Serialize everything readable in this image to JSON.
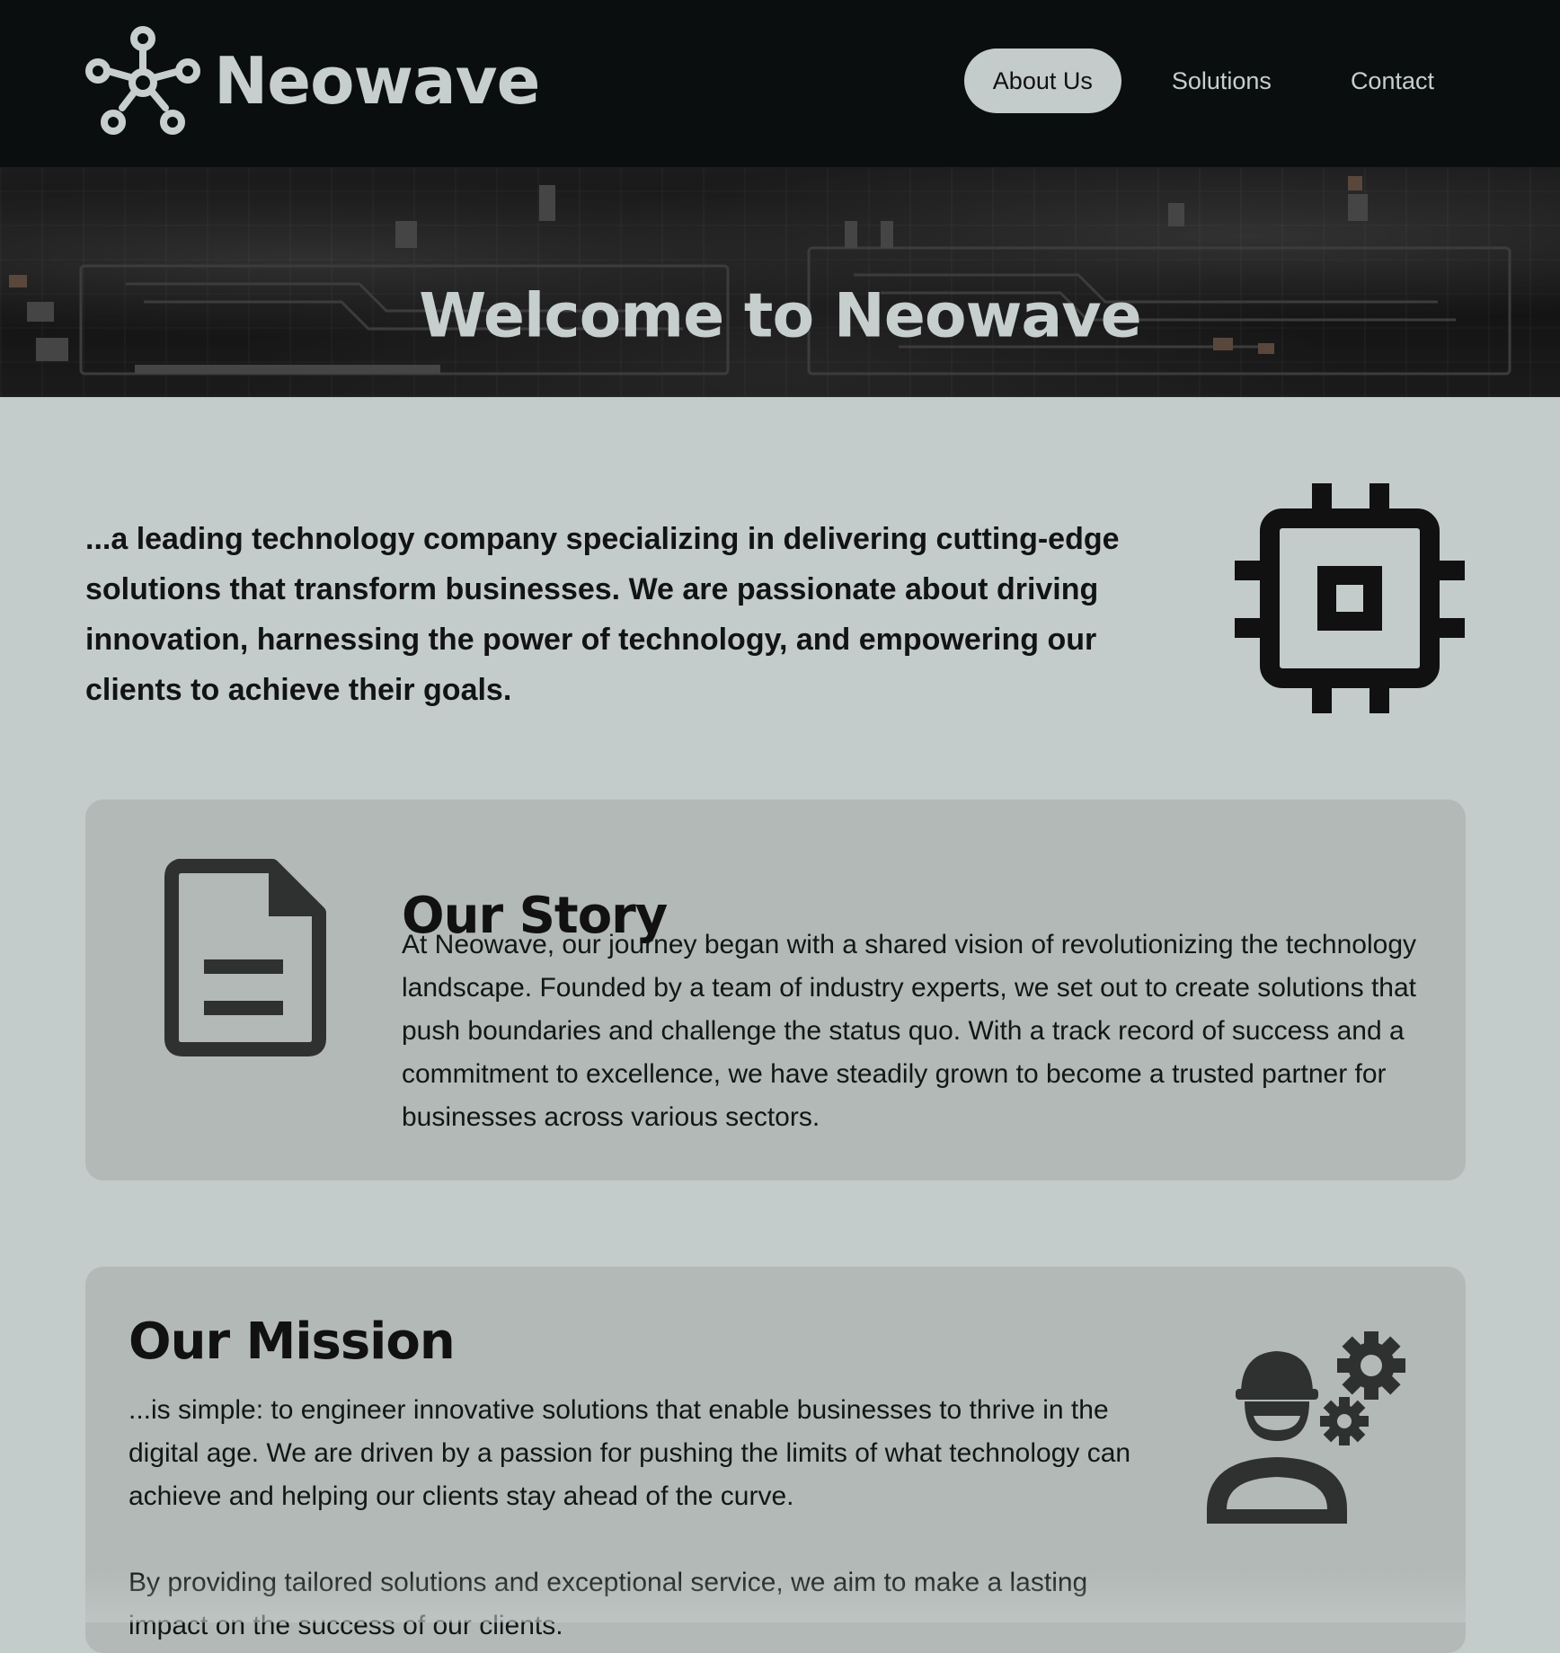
{
  "brand": {
    "name": "Neowave",
    "logo_icon": "network-nodes-icon"
  },
  "nav": {
    "items": [
      {
        "label": "About Us",
        "active": true
      },
      {
        "label": "Solutions",
        "active": false
      },
      {
        "label": "Contact",
        "active": false
      }
    ]
  },
  "hero": {
    "title": "Welcome to Neowave",
    "background": "circuit-board-photo"
  },
  "intro": {
    "text": "...a leading technology company specializing in delivering cutting-edge solutions that transform businesses. We are passionate about driving innovation, harnessing the power of technology, and empowering our clients to achieve their goals.",
    "icon": "chip-icon"
  },
  "story": {
    "title": "Our Story",
    "text": "At Neowave, our journey began with a shared vision of revolutionizing the technology landscape. Founded by a team of industry experts, we set out to create solutions that push boundaries and challenge the status quo. With a track record of success and a commitment to excellence, we have steadily grown to become a trusted partner for businesses across various sectors.",
    "icon": "document-icon"
  },
  "mission": {
    "title": "Our Mission",
    "paragraph1": "...is simple: to engineer innovative solutions that enable businesses to thrive in the digital age. We are driven by a passion for pushing the limits of what technology can achieve and helping our clients stay ahead of the curve.",
    "paragraph2": "By providing tailored solutions and exceptional service, we aim to make a lasting impact on the success of our clients.",
    "icon": "engineer-gears-icon"
  },
  "colors": {
    "header_bg": "#0b0e0e",
    "page_bg": "#c4cbcb",
    "card_bg": "#b2b9b6",
    "nav_active_bg": "#c4cbcb",
    "light_text": "#c7cece",
    "dark_text": "#111111"
  }
}
